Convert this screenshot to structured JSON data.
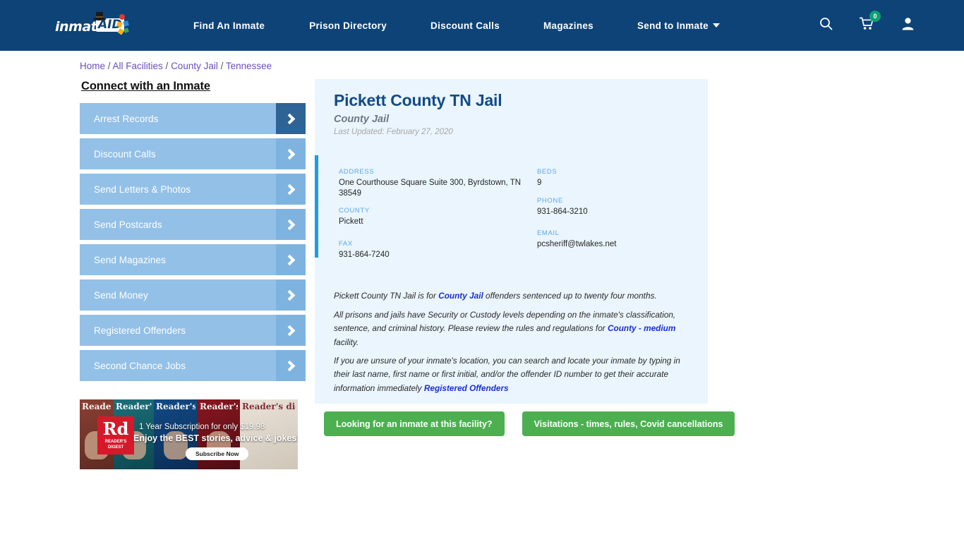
{
  "header": {
    "logo": {
      "text": "inmate",
      "badge": "AID",
      "alt": "inmate-aid-logo"
    },
    "nav": [
      {
        "label": "Find An Inmate"
      },
      {
        "label": "Prison Directory"
      },
      {
        "label": "Discount Calls"
      },
      {
        "label": "Magazines"
      },
      {
        "label": "Send to Inmate",
        "has_caret": true
      }
    ],
    "icons": {
      "search": "search-icon",
      "cart": "cart-icon",
      "cart_badge": "0",
      "account": "user-icon"
    },
    "bg_color": "#0d4377",
    "badge_color": "#0f9e74"
  },
  "breadcrumb": {
    "items": [
      "Home",
      "All Facilities",
      "County Jail",
      "Tennessee"
    ],
    "separator": "/",
    "link_color": "#6b4fbb"
  },
  "sidebar": {
    "title": "Connect with an Inmate",
    "items": [
      {
        "label": "Arrest Records",
        "active": true
      },
      {
        "label": "Discount Calls",
        "active": false
      },
      {
        "label": "Send Letters & Photos",
        "active": false
      },
      {
        "label": "Send Postcards",
        "active": false
      },
      {
        "label": "Send Magazines",
        "active": false
      },
      {
        "label": "Send Money",
        "active": false
      },
      {
        "label": "Registered Offenders",
        "active": false
      },
      {
        "label": "Second Chance Jobs",
        "active": false
      }
    ],
    "item_color": "#93c0e7",
    "active_chevron_color": "#2e6396"
  },
  "ad": {
    "brand_mark": "Rd",
    "brand_sub": "READER'S DIGEST",
    "line1": "1 Year Subscription for only $19.98",
    "line2": "Enjoy the BEST stories, advice & jokes!",
    "cta": "Subscribe Now",
    "covers": [
      "Reader's digest",
      "Reader's digest",
      "Reader's digest",
      "Reader's digest",
      "Reader's digest"
    ]
  },
  "facility": {
    "name": "Pickett County TN Jail",
    "type": "County Jail",
    "last_updated": "Last Updated: February 27, 2020",
    "accent_color": "#1e9bef",
    "card_bg": "#eaf5fd",
    "info": {
      "address_label": "ADDRESS",
      "address_value": "One Courthouse Square Suite 300, Byrdstown, TN 38549",
      "beds_label": "BEDS",
      "beds_value": "9",
      "county_label": "COUNTY",
      "county_value": "Pickett",
      "phone_label": "PHONE",
      "phone_value": "931-864-3210",
      "fax_label": "FAX",
      "fax_value": "931-864-7240",
      "email_label": "EMAIL",
      "email_value": "pcsheriff@twlakes.net"
    },
    "paragraphs": {
      "p1_a": "Pickett County TN Jail is for ",
      "p1_link": "County Jail",
      "p1_b": " offenders sentenced up to twenty four months.",
      "p2_a": "All prisons and jails have Security or Custody levels depending on the inmate's classification, sentence, and criminal history. Please review the rules and regulations for ",
      "p2_link": "County - medium",
      "p2_b": " facility.",
      "p3_a": "If you are unsure of your inmate's location, you can search and locate your inmate by typing in their last name, first name or first initial, and/or the offender ID number to get their accurate information immediately ",
      "p3_link": "Registered Offenders"
    }
  },
  "cta": {
    "primary": "Looking for an inmate at this facility?",
    "secondary": "Visitations - times, rules, Covid cancellations",
    "color": "#4caf50"
  }
}
